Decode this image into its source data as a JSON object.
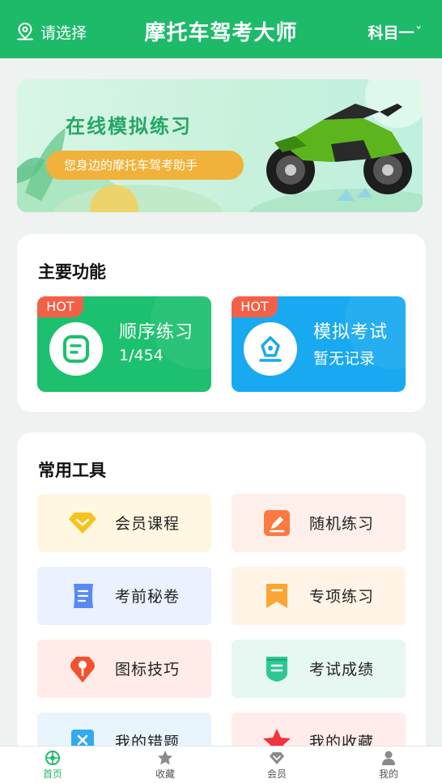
{
  "header": {
    "location_label": "请选择",
    "title": "摩托车驾考大师",
    "subject": "科目一",
    "colors": {
      "primary": "#1dba6a"
    }
  },
  "banner": {
    "title": "在线模拟练习",
    "tagline": "您身边的摩托车驾考助手"
  },
  "main_features": {
    "heading": "主要功能",
    "items": [
      {
        "badge": "HOT",
        "name": "顺序练习",
        "sub": "1/454",
        "icon": "note-icon",
        "color": "#1dc06f"
      },
      {
        "badge": "HOT",
        "name": "模拟考试",
        "sub": "暂无记录",
        "icon": "pen-nib-icon",
        "color": "#19a9f0"
      }
    ]
  },
  "tools": {
    "heading": "常用工具",
    "items": [
      {
        "label": "会员课程",
        "icon": "diamond-icon"
      },
      {
        "label": "随机练习",
        "icon": "edit-icon"
      },
      {
        "label": "考前秘卷",
        "icon": "scroll-icon"
      },
      {
        "label": "专项练习",
        "icon": "bookmark-icon"
      },
      {
        "label": "图标技巧",
        "icon": "location-pin-icon"
      },
      {
        "label": "考试成绩",
        "icon": "shield-list-icon"
      },
      {
        "label": "我的错题",
        "icon": "wrong-doc-icon"
      },
      {
        "label": "我的收藏",
        "icon": "star-icon"
      }
    ]
  },
  "tabbar": {
    "items": [
      {
        "label": "首页",
        "icon": "home-wheel-icon",
        "active": true
      },
      {
        "label": "收藏",
        "icon": "star-icon"
      },
      {
        "label": "会员",
        "icon": "vip-diamond-icon"
      },
      {
        "label": "我的",
        "icon": "person-icon"
      }
    ]
  }
}
